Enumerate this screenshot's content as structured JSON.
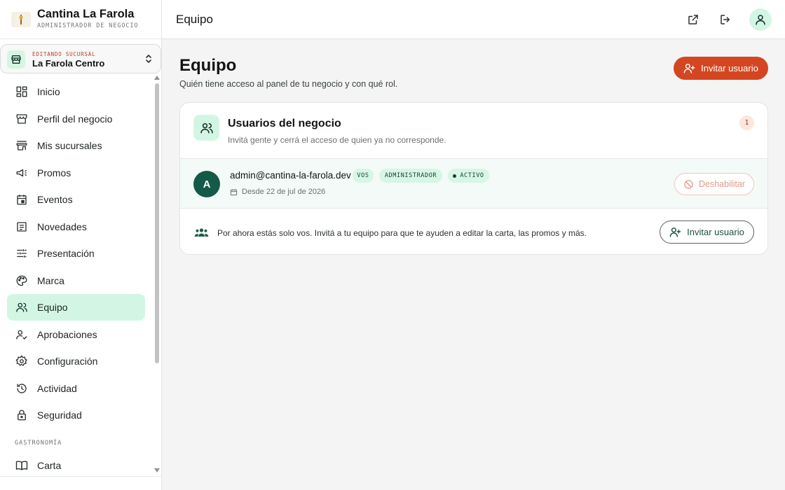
{
  "brand": {
    "name": "Cantina La Farola",
    "subtitle": "ADMINISTRADOR DE NEGOCIO"
  },
  "branch": {
    "kicker": "EDITANDO SUCURSAL",
    "name": "La Farola Centro"
  },
  "sidebar": {
    "items": [
      {
        "label": "Inicio",
        "icon": "dashboard-icon"
      },
      {
        "label": "Perfil del negocio",
        "icon": "store-icon"
      },
      {
        "label": "Mis sucursales",
        "icon": "storefront-icon"
      },
      {
        "label": "Promos",
        "icon": "megaphone-icon"
      },
      {
        "label": "Eventos",
        "icon": "calendar-event-icon"
      },
      {
        "label": "Novedades",
        "icon": "article-icon"
      },
      {
        "label": "Presentación",
        "icon": "sliders-icon"
      },
      {
        "label": "Marca",
        "icon": "palette-icon"
      },
      {
        "label": "Equipo",
        "icon": "team-icon",
        "active": true
      },
      {
        "label": "Aprobaciones",
        "icon": "user-check-icon"
      },
      {
        "label": "Configuración",
        "icon": "gear-icon"
      },
      {
        "label": "Actividad",
        "icon": "history-icon"
      },
      {
        "label": "Seguridad",
        "icon": "lock-icon"
      }
    ],
    "section_label": "GASTRONOMÍA",
    "section_items": [
      {
        "label": "Carta",
        "icon": "book-icon"
      }
    ]
  },
  "topbar": {
    "title": "Equipo"
  },
  "page": {
    "title": "Equipo",
    "subtitle": "Quién tiene acceso al panel de tu negocio y con qué rol.",
    "invite_label": "Invitar usuario"
  },
  "card": {
    "title": "Usuarios del negocio",
    "subtitle": "Invitá gente y cerrá el acceso de quien ya no corresponde.",
    "count": "1"
  },
  "user": {
    "initial": "A",
    "email": "admin@cantina-la-farola.dev",
    "badge_self": "VOS",
    "badge_role": "ADMINISTRADOR",
    "badge_status": "ACTIVO",
    "since": "Desde 22 de jul de 2026",
    "disable_label": "Deshabilitar"
  },
  "solo": {
    "text": "Por ahora estás solo vos. Invitá a tu equipo para que te ayuden a editar la carta, las promos y más.",
    "invite_label": "Invitar usuario"
  },
  "colors": {
    "accent": "#d44622",
    "mint": "#d3f6e4",
    "dark_green": "#145a48"
  }
}
